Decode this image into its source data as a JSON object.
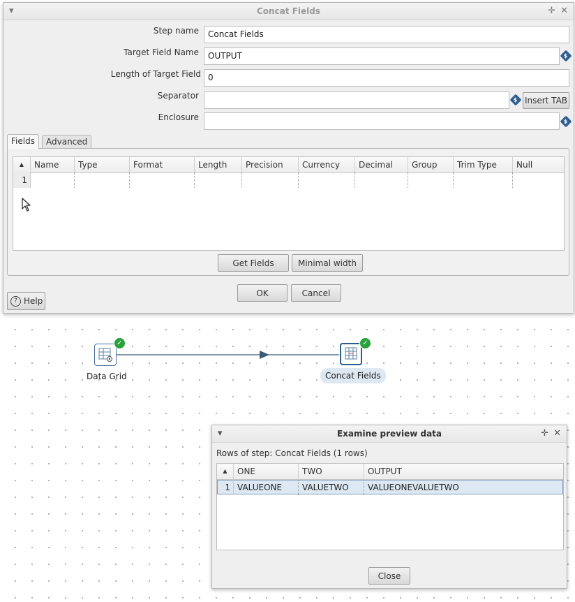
{
  "dialog": {
    "title": "Concat Fields",
    "menu_icon": "▾",
    "pin_icon": "✛",
    "close_icon": "✕",
    "labels": {
      "step_name": "Step name",
      "target_field_name": "Target Field Name",
      "length_of_target_field": "Length of Target Field",
      "separator": "Separator",
      "enclosure": "Enclosure"
    },
    "values": {
      "step_name": "Concat Fields",
      "target_field_name": "OUTPUT",
      "length_of_target_field": "0",
      "separator": "",
      "enclosure": ""
    },
    "variable_icon_glyph": "$",
    "insert_tab_label": "Insert TAB",
    "tabs": [
      {
        "label": "Fields",
        "active": true
      },
      {
        "label": "Advanced",
        "active": false
      }
    ],
    "grid": {
      "sort_glyph": "▲",
      "columns": [
        "Name",
        "Type",
        "Format",
        "Length",
        "Precision",
        "Currency",
        "Decimal",
        "Group",
        "Trim Type",
        "Null"
      ],
      "rows": [
        {
          "num": "1",
          "cells": [
            "",
            "",
            "",
            "",
            "",
            "",
            "",
            "",
            "",
            ""
          ]
        }
      ]
    },
    "get_fields_label": "Get Fields",
    "minimal_width_label": "Minimal width",
    "ok_label": "OK",
    "cancel_label": "Cancel",
    "help_label": "Help",
    "help_glyph": "?"
  },
  "canvas": {
    "steps": [
      {
        "label": "Data Grid",
        "status": "ok"
      },
      {
        "label": "Concat Fields",
        "status": "ok"
      }
    ],
    "check_glyph": "✓",
    "hop_color": "#3a5a78"
  },
  "preview": {
    "title": "Examine preview data",
    "menu_icon": "▾",
    "pin_icon": "✛",
    "close_icon": "✕",
    "rows_info": "Rows of step: Concat Fields (1 rows)",
    "sort_glyph": "▲",
    "columns": [
      "ONE",
      "TWO",
      "OUTPUT"
    ],
    "rows": [
      {
        "num": "1",
        "cells": [
          "VALUEONE",
          "VALUETWO",
          "VALUEONEVALUETWO"
        ]
      }
    ],
    "close_label": "Close"
  },
  "colors": {
    "accent": "#2f5f8f",
    "ok_green": "#27a33a",
    "selected_row": "#dde8f3"
  }
}
